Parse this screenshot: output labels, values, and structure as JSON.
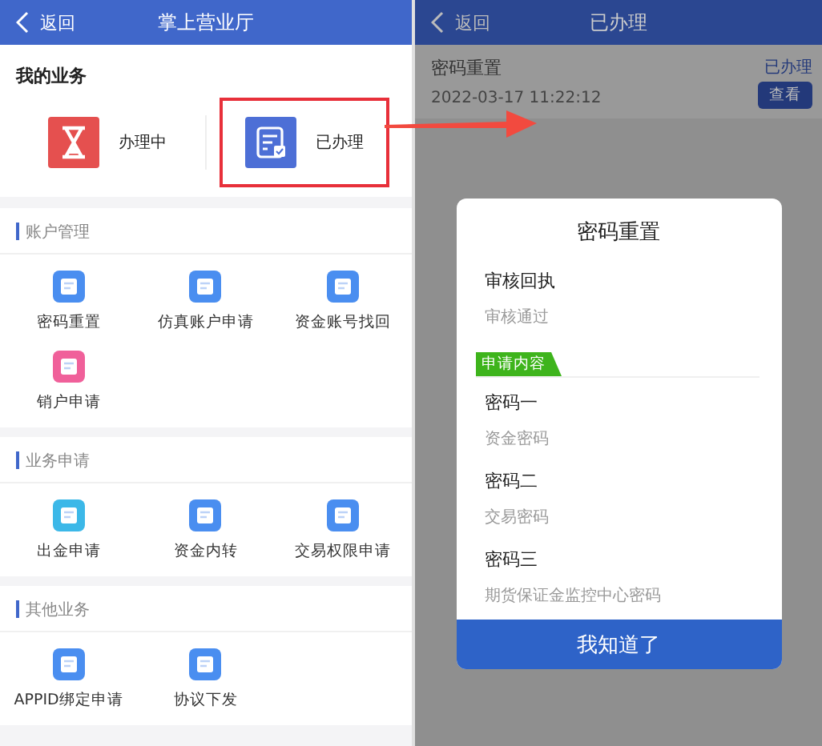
{
  "left": {
    "header": {
      "back": "返回",
      "title": "掌上营业厅"
    },
    "my_business": {
      "title": "我的业务",
      "items": [
        {
          "label": "办理中",
          "kind": "pending",
          "highlighted": false
        },
        {
          "label": "已办理",
          "kind": "done",
          "highlighted": true
        }
      ]
    },
    "sections": [
      {
        "title": "账户管理",
        "items": [
          {
            "label": "密码重置",
            "color": "#4a8ef0"
          },
          {
            "label": "仿真账户申请",
            "color": "#4a8ef0"
          },
          {
            "label": "资金账号找回",
            "color": "#4a8ef0"
          },
          {
            "label": "销户申请",
            "color": "#f0609a"
          }
        ]
      },
      {
        "title": "业务申请",
        "items": [
          {
            "label": "出金申请",
            "color": "#3cb8e8"
          },
          {
            "label": "资金内转",
            "color": "#4a8ef0"
          },
          {
            "label": "交易权限申请",
            "color": "#4a8ef0"
          }
        ]
      },
      {
        "title": "其他业务",
        "items": [
          {
            "label": "APPID绑定申请",
            "color": "#4a8ef0"
          },
          {
            "label": "协议下发",
            "color": "#4a8ef0"
          }
        ]
      }
    ]
  },
  "right": {
    "header": {
      "back": "返回",
      "title": "已办理"
    },
    "record": {
      "name": "密码重置",
      "time": "2022-03-17 11:22:12",
      "status": "已办理",
      "button": "查看"
    },
    "dialog": {
      "title": "密码重置",
      "receipt": {
        "label": "审核回执",
        "value": "审核通过"
      },
      "tag": "申请内容",
      "fields": [
        {
          "label": "密码一",
          "value": "资金密码"
        },
        {
          "label": "密码二",
          "value": "交易密码"
        },
        {
          "label": "密码三",
          "value": "期货保证金监控中心密码"
        }
      ],
      "button": "我知道了"
    }
  }
}
